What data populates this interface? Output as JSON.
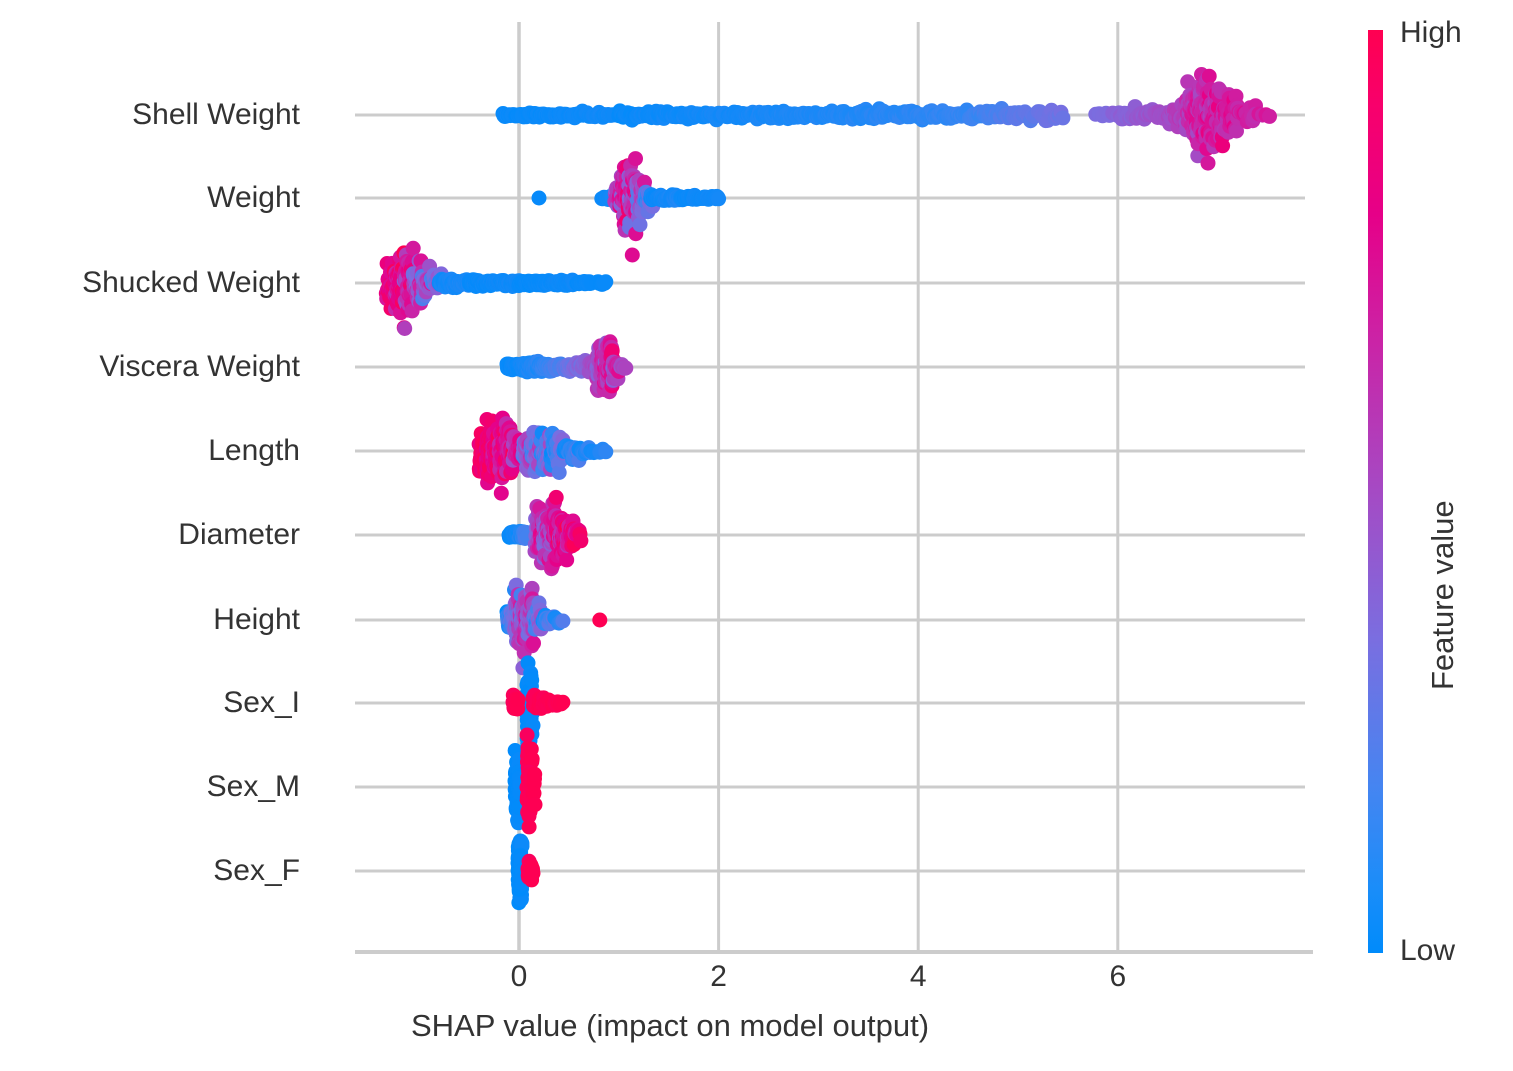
{
  "chart_data": {
    "type": "scatter",
    "plot_kind": "shap-beeswarm",
    "title": "",
    "xlabel": "SHAP value (impact on model output)",
    "ylabel": "",
    "xticks": [
      0,
      2,
      4,
      6
    ],
    "xticklabels": [
      "0",
      "2",
      "4",
      "6"
    ],
    "xlim": [
      -1.6,
      7.9
    ],
    "grid": true,
    "grid_axis": "x",
    "features": [
      "Shell Weight",
      "Weight",
      "Shucked Weight",
      "Viscera Weight",
      "Length",
      "Diameter",
      "Height",
      "Sex_I",
      "Sex_M",
      "Sex_F"
    ],
    "colorbar": {
      "title": "Feature value",
      "high_label": "High",
      "low_label": "Low",
      "low_color": "#008bfb",
      "mid_color": "#a54ac4",
      "high_color": "#ff0051",
      "position": "right"
    },
    "series": [
      {
        "name": "Shell Weight",
        "row": 0,
        "shap_range": [
          -0.18,
          7.5
        ],
        "dense_band": [
          -0.15,
          5.4
        ],
        "cluster_center": 6.85,
        "color_trend": "low (blue) at negative/small SHAP, high (red) at large positive SHAP"
      },
      {
        "name": "Weight",
        "row": 1,
        "shap_range": [
          -0.07,
          2.0
        ],
        "dense_band": [
          0.82,
          1.35
        ],
        "cluster_center": 1.12,
        "color_trend": "mixed red/purple cluster near 1.1, blue tail to 2.0"
      },
      {
        "name": "Shucked Weight",
        "row": 2,
        "shap_range": [
          -1.33,
          0.86
        ],
        "dense_band": [
          -1.25,
          -0.75
        ],
        "cluster_center": -1.12,
        "color_trend": "red/high cluster at strongly negative SHAP, blue tail toward zero and positive"
      },
      {
        "name": "Viscera Weight",
        "row": 3,
        "shap_range": [
          -0.12,
          1.06
        ],
        "dense_band": [
          -0.1,
          0.95
        ],
        "cluster_center": 0.85,
        "color_trend": "blue near zero, purple/red cluster near 0.85"
      },
      {
        "name": "Length",
        "row": 4,
        "shap_range": [
          -0.4,
          0.9
        ],
        "dense_band": [
          -0.32,
          0.6
        ],
        "cluster_center": 0.22,
        "color_trend": "red/high at negative SHAP, blue/purple at positive SHAP"
      },
      {
        "name": "Diameter",
        "row": 5,
        "shap_range": [
          -0.1,
          0.62
        ],
        "dense_band": [
          -0.08,
          0.55
        ],
        "cluster_center": 0.38,
        "color_trend": "blue near/below zero, red cluster near 0.4"
      },
      {
        "name": "Height",
        "row": 6,
        "shap_range": [
          -0.12,
          0.82
        ],
        "dense_band": [
          -0.1,
          0.35
        ],
        "cluster_center": 0.08,
        "color_trend": "mixed blue/red near zero, one red outlier near 0.8"
      },
      {
        "name": "Sex_I",
        "row": 7,
        "shap_range": [
          -0.06,
          0.42
        ],
        "dense_band": [
          0.0,
          0.12
        ],
        "cluster_center": 0.05,
        "color_trend": "blue vertical column at ~0.1, red spread to 0.42"
      },
      {
        "name": "Sex_M",
        "row": 8,
        "shap_range": [
          -0.06,
          0.18
        ],
        "dense_band": [
          -0.04,
          0.15
        ],
        "cluster_center": 0.04,
        "color_trend": "blue column just below zero, red column just above zero"
      },
      {
        "name": "Sex_F",
        "row": 9,
        "shap_range": [
          -0.05,
          0.14
        ],
        "dense_band": [
          -0.02,
          0.1
        ],
        "cluster_center": 0.03,
        "color_trend": "blue column at zero, small red cluster just positive"
      }
    ]
  }
}
